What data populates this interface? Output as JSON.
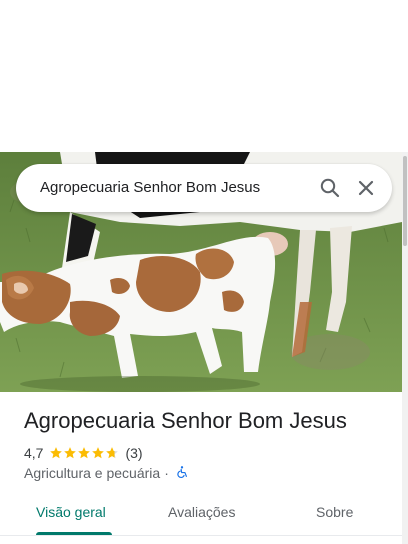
{
  "search": {
    "query": "Agropecuaria Senhor Bom Jesus",
    "search_icon": "search-icon",
    "close_icon": "close-icon"
  },
  "hero": {
    "photo": "calf-and-cow-photo"
  },
  "place": {
    "title": "Agropecuaria Senhor Bom Jesus",
    "rating": "4,7",
    "rating_value": 4.7,
    "review_count": "(3)",
    "category": "Agricultura e pecuária",
    "separator": "·",
    "accessibility_icon": "wheelchair-icon"
  },
  "tabs": [
    {
      "label": "Visão geral",
      "active": true
    },
    {
      "label": "Avaliações",
      "active": false
    },
    {
      "label": "Sobre",
      "active": false
    }
  ],
  "colors": {
    "accent": "#00796b",
    "star": "#fbbc04",
    "accessibility": "#1a73e8"
  }
}
